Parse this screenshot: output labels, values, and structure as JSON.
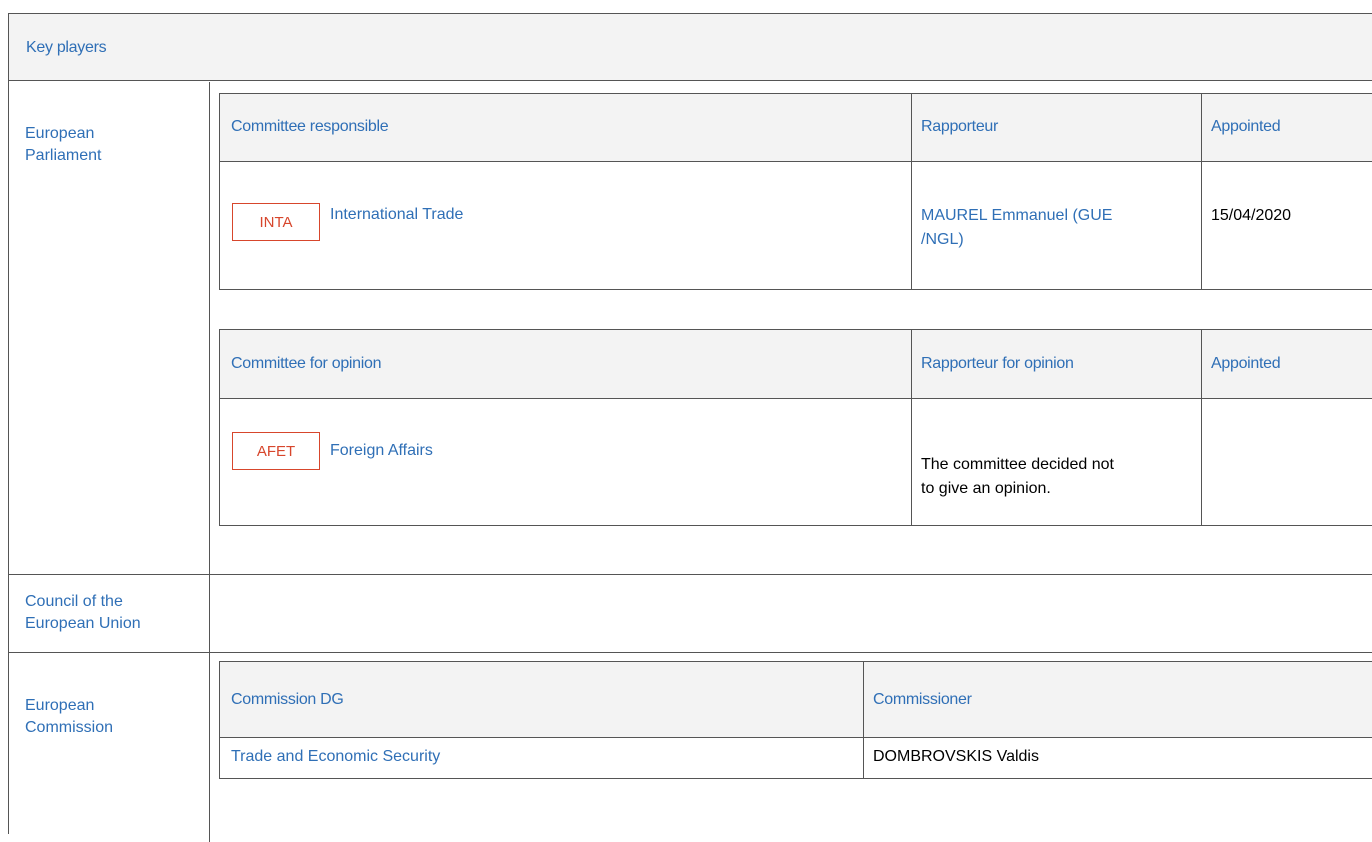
{
  "title": "Key players",
  "parliament": {
    "label_line1": "European",
    "label_line2": "Parliament",
    "responsible": {
      "col_committee": "Committee responsible",
      "col_rapporteur": "Rapporteur",
      "col_appointed": "Appointed",
      "tag": "INTA",
      "committee": "International Trade",
      "rapporteur_line1": "MAUREL Emmanuel (GUE",
      "rapporteur_line2": "/NGL)",
      "appointed": "15/04/2020"
    },
    "opinion": {
      "col_committee": "Committee for opinion",
      "col_rapporteur": "Rapporteur for opinion",
      "col_appointed": "Appointed",
      "tag": "AFET",
      "committee": "Foreign Affairs",
      "note_line1": "The committee decided not",
      "note_line2": "to give an opinion."
    }
  },
  "council": {
    "label_line1": "Council of the",
    "label_line2": "European Union"
  },
  "commission": {
    "label_line1": "European",
    "label_line2": "Commission",
    "col_dg": "Commission DG",
    "col_commissioner": "Commissioner",
    "dg": "Trade and Economic Security",
    "commissioner": "DOMBROVSKIS Valdis"
  },
  "colors": {
    "link": "#2f6fb6",
    "tag": "#d7462c",
    "header_bg": "#f3f3f3",
    "border": "#555555"
  }
}
